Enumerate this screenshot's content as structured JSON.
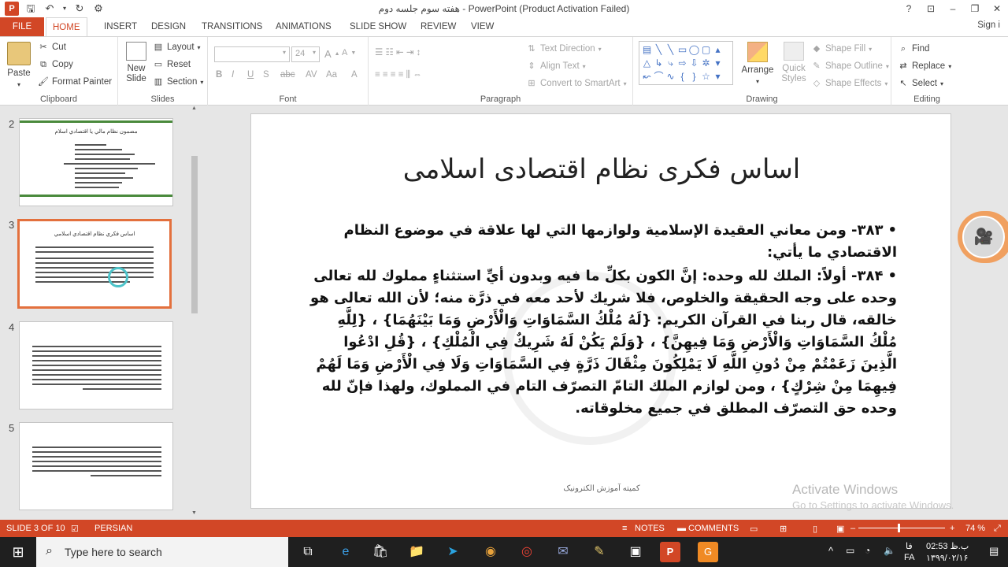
{
  "window": {
    "title": "هفته سوم جلسه دوم - PowerPoint (Product Activation Failed)",
    "signin": "Sign i",
    "controls": [
      "?",
      "⊡",
      "–",
      "❐",
      "✕"
    ]
  },
  "tabs": [
    "FILE",
    "HOME",
    "INSERT",
    "DESIGN",
    "TRANSITIONS",
    "ANIMATIONS",
    "SLIDE SHOW",
    "REVIEW",
    "VIEW"
  ],
  "ribbon": {
    "clipboard": {
      "paste": "Paste",
      "cut": "Cut",
      "copy": "Copy",
      "format_painter": "Format Painter",
      "label": "Clipboard"
    },
    "slides": {
      "new_slide": "New Slide",
      "layout": "Layout",
      "reset": "Reset",
      "section": "Section",
      "label": "Slides"
    },
    "font": {
      "size": "24",
      "label": "Font"
    },
    "paragraph": {
      "text_direction": "Text Direction",
      "align_text": "Align Text",
      "convert": "Convert to SmartArt",
      "label": "Paragraph"
    },
    "drawing": {
      "arrange": "Arrange",
      "quick_styles": "Quick Styles",
      "shape_fill": "Shape Fill",
      "shape_outline": "Shape Outline",
      "shape_effects": "Shape Effects",
      "label": "Drawing"
    },
    "editing": {
      "find": "Find",
      "replace": "Replace",
      "select": "Select",
      "label": "Editing"
    }
  },
  "thumbnails": [
    {
      "num": "2",
      "title": "مضمون نظام مالي يا اقتصادي اسلام"
    },
    {
      "num": "3",
      "title": "اساس فكري نظام اقتصادي اسلامي"
    },
    {
      "num": "4",
      "title": ""
    },
    {
      "num": "5",
      "title": ""
    }
  ],
  "slide": {
    "title": "اساس فکری نظام اقتصادی اسلامی",
    "bullets": [
      "۳۸۳- ومن معاني العقيدة الإسلامية ولوازمها التي لها علاقة في موضوع النظام الاقتصادي ما يأتي:",
      "۳۸۴- أولاً: الملك لله وحده: إنَّ الكون بكلِّ ما فيه وبدون أيِّ استثناءٍ مملوك لله تعالى وحده على وجه الحقيقة والخلوص، فلا شريك لأحد معه في ذرَّة منه؛ لأن الله تعالى هو خالقه، قال ربنا في القرآن الكريم: {لَهُ مُلْكُ السَّمَاوَاتِ وَالْأَرْضِ وَمَا بَيْنَهُمَا} ، {لِلَّهِ مُلْكُ السَّمَاوَاتِ وَالْأَرْضِ وَمَا فِيهِنَّ} ، {وَلَمْ يَكُنْ لَهُ شَرِيكٌ فِي الْمُلْكِ} ، {قُلِ ادْعُوا الَّذِينَ زَعَمْتُمْ مِنْ دُونِ اللَّهِ لَا يَمْلِكُونَ مِثْقَالَ ذَرَّةٍ فِي السَّمَاوَاتِ وَلَا فِي الْأَرْضِ وَمَا لَهُمْ فِيهِمَا مِنْ شِرْكٍ} ، ومن لوازم الملك التامّ التصرّف التام في المملوك، ولهذا فإنّ لله وحده حق التصرّف المطلق في جميع مخلوقاته."
    ],
    "footer": "کمیته آموزش الکترونیک"
  },
  "activation": {
    "line1": "Activate Windows",
    "line2": "Go to Settings to activate Windows."
  },
  "status": {
    "slide": "SLIDE 3 OF 10",
    "language": "PERSIAN",
    "notes": "NOTES",
    "comments": "COMMENTS",
    "zoom": "74 %"
  },
  "taskbar": {
    "search_placeholder": "Type here to search",
    "time": "02:53 ب.ظ",
    "date": "۱۳۹۹/۰۲/۱۶",
    "lang": "فا",
    "lang2": "FA"
  },
  "colors": {
    "accent": "#d24726",
    "selected_thumb": "#e3703d"
  }
}
